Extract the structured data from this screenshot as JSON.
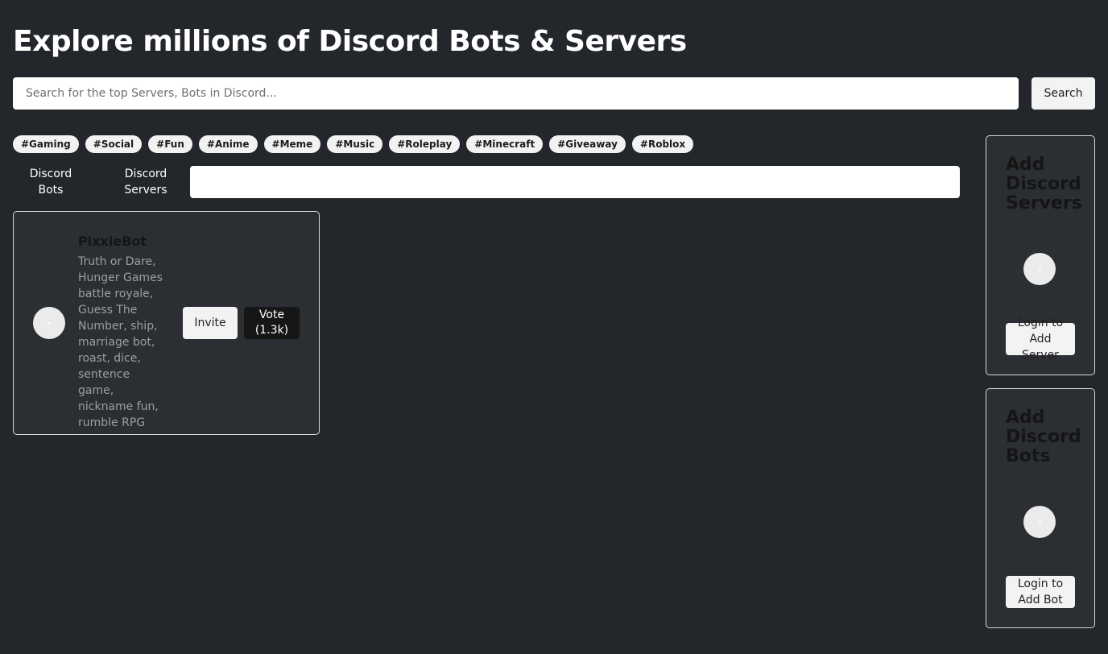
{
  "header": {
    "title": "Explore millions of Discord Bots & Servers"
  },
  "search": {
    "placeholder": "Search for the top Servers, Bots in Discord...",
    "button_label": "Search"
  },
  "tags": [
    "#Gaming",
    "#Social",
    "#Fun",
    "#Anime",
    "#Meme",
    "#Music",
    "#Roleplay",
    "#Minecraft",
    "#Giveaway",
    "#Roblox"
  ],
  "tabs": {
    "bots": "Discord Bots",
    "servers": "Discord Servers"
  },
  "filter": {
    "value": ""
  },
  "bots": [
    {
      "name": "PixxieBot",
      "description": "Truth or Dare, Hunger Games battle royale, Guess The Number, ship, marriage bot, roast, dice, sentence game, nickname fun, rumble RPG",
      "invite_label": "Invite",
      "vote_label": "Vote (1.3k)"
    }
  ],
  "sidebar": {
    "add_servers": {
      "title": "Add Discord Servers",
      "button_label": "Login to Add Server"
    },
    "add_bots": {
      "title": "Add Discord Bots",
      "button_label": "Login to Add Bot"
    }
  },
  "colors": {
    "background": "#23262a",
    "card": "#2b2e33",
    "button_light": "#f3f3f4",
    "button_dark": "#161616"
  }
}
